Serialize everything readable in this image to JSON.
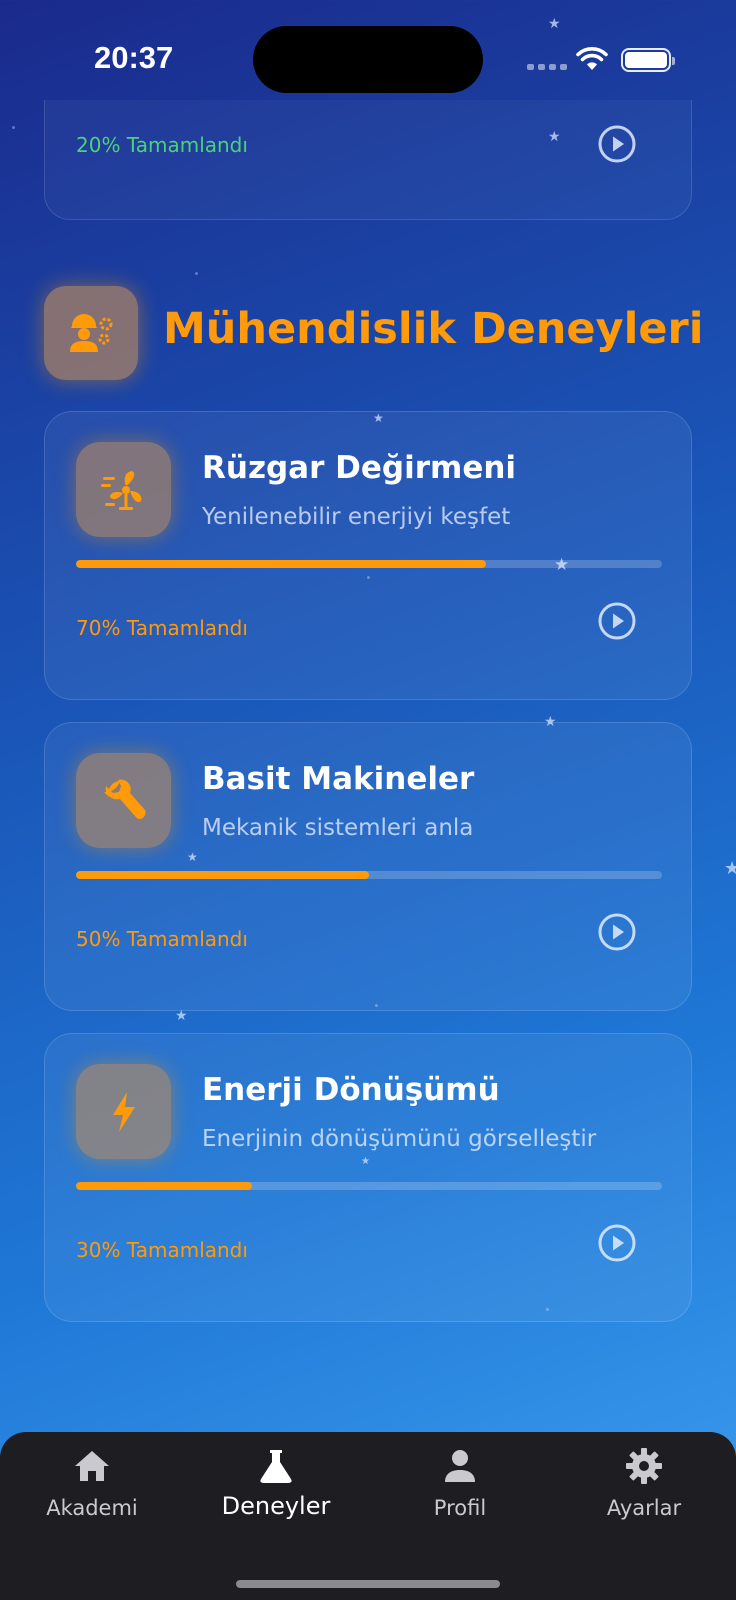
{
  "status_bar": {
    "time": "20:37"
  },
  "top_card": {
    "progress_text": "20% Tamamlandı",
    "progress_color": "#4cd07a"
  },
  "section": {
    "title": "Mühendislik Deneyleri",
    "icon": "engineer-gears-icon"
  },
  "experiments": [
    {
      "title": "Rüzgar Değirmeni",
      "subtitle": "Yenilenebilir enerjiyi keşfet",
      "progress": 0.7,
      "progress_text": "70% Tamamlandı",
      "icon": "wind-turbine-icon"
    },
    {
      "title": "Basit Makineler",
      "subtitle": "Mekanik sistemleri anla",
      "progress": 0.5,
      "progress_text": "50% Tamamlandı",
      "icon": "wrench-icon"
    },
    {
      "title": "Enerji Dönüşümü",
      "subtitle": "Enerjinin dönüşümünü görselleştir",
      "progress": 0.3,
      "progress_text": "30% Tamamlandı",
      "icon": "lightning-bolt-icon"
    }
  ],
  "nav": {
    "items": [
      {
        "label": "Akademi",
        "icon": "home-icon",
        "active": false
      },
      {
        "label": "Deneyler",
        "icon": "flask-icon",
        "active": true
      },
      {
        "label": "Profil",
        "icon": "person-icon",
        "active": false
      },
      {
        "label": "Ayarlar",
        "icon": "gear-icon",
        "active": false
      }
    ]
  },
  "colors": {
    "accent": "#ff9a0a",
    "nav_background": "#1e1e22"
  }
}
